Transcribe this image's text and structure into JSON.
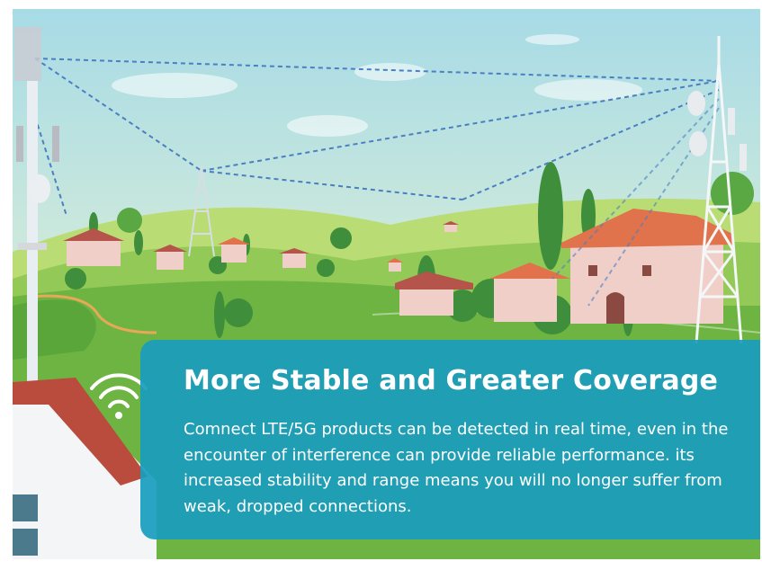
{
  "banner": {
    "title": "More Stable and Greater Coverage",
    "description": "Comnect LTE/5G products can be detected in real time, even in the encounter of interference can provide reliable performance. its increased stability and range means you will no longer suffer from weak, dropped connections."
  },
  "colors": {
    "panel": "#199cbe",
    "sky_top": "#a9dbe6",
    "sky_bottom": "#e9f2dc",
    "grass": "#7fbf4a",
    "roof": "#e0734c",
    "wall": "#f1cfc9",
    "signal": "#4a7fc2"
  },
  "icons": [
    "wifi-signal-icon"
  ]
}
